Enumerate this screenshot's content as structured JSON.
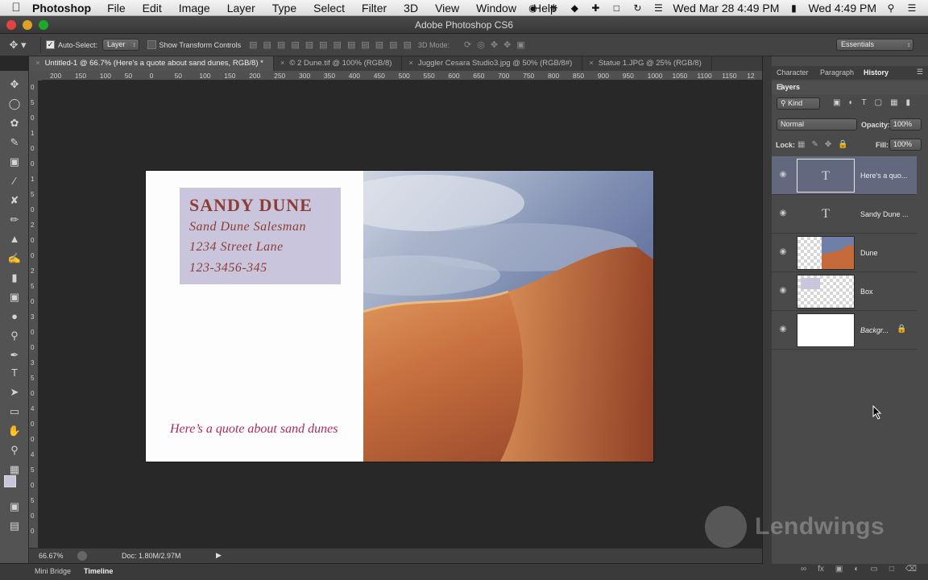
{
  "menubar": {
    "app_name": "Photoshop",
    "items": [
      "File",
      "Edit",
      "Image",
      "Layer",
      "Type",
      "Select",
      "Filter",
      "3D",
      "View",
      "Window",
      "Help"
    ],
    "clock_date": "Wed Mar 28  4:49 PM",
    "clock_time": "Wed 4:49 PM"
  },
  "window": {
    "title": "Adobe Photoshop CS6"
  },
  "options_bar": {
    "auto_select_label": "Auto-Select:",
    "auto_select_value": "Layer",
    "show_transform_label": "Show Transform Controls",
    "mode_3d_label": "3D Mode:",
    "workspace_value": "Essentials"
  },
  "doc_tabs": [
    {
      "label": "Untitled-1 @ 66.7% (Here's a quote about sand dunes, RGB/8) *"
    },
    {
      "label": "© 2 Dune.tif @ 100% (RGB/8)"
    },
    {
      "label": "Juggler Cesara Studio3.jpg @ 50% (RGB/8#)"
    },
    {
      "label": "Statue 1.JPG @ 25% (RGB/8)"
    }
  ],
  "ruler_h": [
    "200",
    "150",
    "100",
    "50",
    "0",
    "50",
    "100",
    "150",
    "200",
    "250",
    "300",
    "350",
    "400",
    "450",
    "500",
    "550",
    "600",
    "650",
    "700",
    "750",
    "800",
    "850",
    "900",
    "950",
    "1000",
    "1050",
    "1100",
    "1150",
    "12"
  ],
  "ruler_v": [
    "0",
    "5",
    "0",
    "1",
    "0",
    "0",
    "1",
    "5",
    "0",
    "2",
    "0",
    "0",
    "2",
    "5",
    "0",
    "3",
    "0",
    "0",
    "3",
    "5",
    "0",
    "4",
    "0",
    "0",
    "4",
    "5",
    "0",
    "5",
    "0",
    "0"
  ],
  "card": {
    "name": "SANDY DUNE",
    "title": "Sand Dune Salesman",
    "address": "1234 Street Lane",
    "phone": "123-3456-345",
    "quote": "Here’s a quote about sand dunes"
  },
  "status_bar": {
    "zoom": "66.67%",
    "doc_size": "Doc: 1.80M/2.97M"
  },
  "bottom_tabs": [
    "Mini Bridge",
    "Timeline"
  ],
  "panels": {
    "top_tabs": [
      "Character",
      "Paragraph",
      "History"
    ],
    "layers_title": "Layers",
    "kind_label": "Kind",
    "blend_mode": "Normal",
    "opacity_label": "Opacity:",
    "opacity_value": "100%",
    "lock_label": "Lock:",
    "fill_label": "Fill:",
    "fill_value": "100%"
  },
  "layers": [
    {
      "name": "Here's a quo...",
      "type": "text",
      "selected": true
    },
    {
      "name": "Sandy Dune ...",
      "type": "text",
      "selected": false
    },
    {
      "name": "Dune",
      "type": "image",
      "selected": false
    },
    {
      "name": "Box",
      "type": "shape",
      "selected": false
    },
    {
      "name": "Backgr...",
      "type": "background",
      "selected": false,
      "locked": true
    }
  ],
  "watermark": {
    "text": "Lendwings"
  },
  "colors": {
    "card_text": "#8e3d35",
    "quote_text": "#b0295e",
    "name_box": "#c9c5dc",
    "selected_layer": "#62697f"
  }
}
